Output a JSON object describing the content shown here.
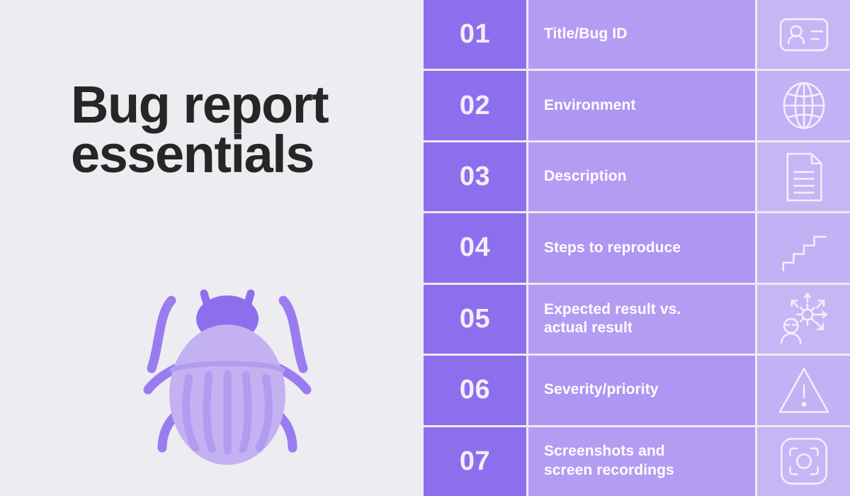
{
  "page": {
    "background_color": "#edecf1",
    "title": "Bug report\nessentials"
  },
  "illustration": {
    "name": "bug-illustration",
    "body_color": "#c4b1f2",
    "stripe_color": "#b29cf0",
    "head_color": "#8d6fee",
    "leg_color": "#9a7cf0"
  },
  "palette": {
    "number_cell": "#8d6fee",
    "label_cell": "#b49cf3",
    "label_cell_alt": "#ae96f2",
    "icon_cell": "#c7b6f5",
    "icon_cell_alt": "#c3b1f5",
    "text_light": "#ffffff",
    "number_text": "#f1eefb",
    "title_text": "#262626"
  },
  "rows": [
    {
      "number": "01",
      "label": "Title/Bug ID",
      "icon": "id-card-icon"
    },
    {
      "number": "02",
      "label": "Environment",
      "icon": "globe-icon"
    },
    {
      "number": "03",
      "label": "Description",
      "icon": "document-lines-icon"
    },
    {
      "number": "04",
      "label": "Steps to reproduce",
      "icon": "stairs-icon"
    },
    {
      "number": "05",
      "label": "Expected result vs.\nactual result",
      "icon": "person-gear-arrows-icon"
    },
    {
      "number": "06",
      "label": "Severity/priority",
      "icon": "warning-triangle-icon"
    },
    {
      "number": "07",
      "label": "Screenshots and\nscreen recordings",
      "icon": "screenshot-frame-icon"
    }
  ]
}
